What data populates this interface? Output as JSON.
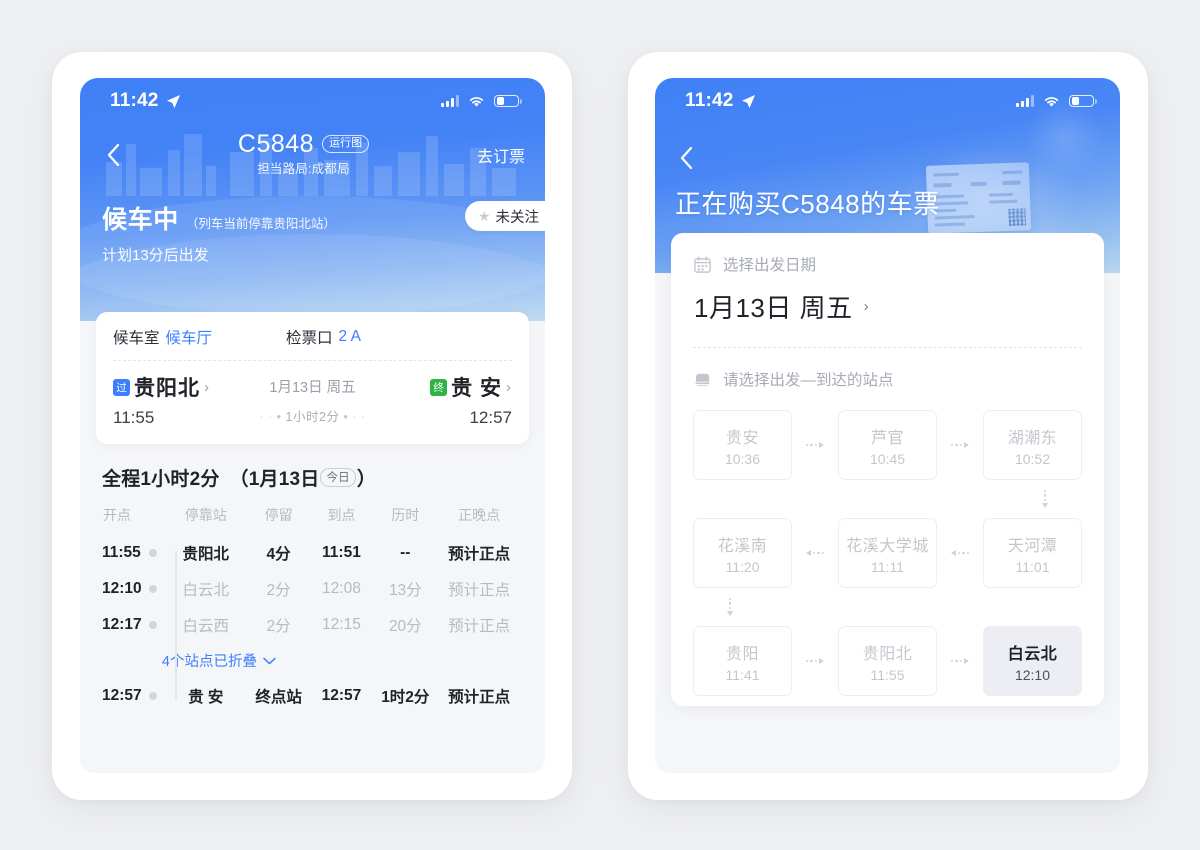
{
  "background_color": "#eff0f2",
  "accent_color": "#3d7eff",
  "header_color": "#3f80f6",
  "left_phone": {
    "status_bar": {
      "time": "11:42",
      "location_icon": "location-arrow-icon",
      "signal_icon": "cellular-signal-icon",
      "wifi_icon": "wifi-icon",
      "battery_icon": "battery-low-icon"
    },
    "nav": {
      "back_icon": "chevron-left-icon",
      "train_number": "C5848",
      "diagram_tag": "运行图",
      "bureau": "担当路局:成都局",
      "book_ticket": "去订票"
    },
    "status": {
      "main": "候车中",
      "sub": "（列车当前停靠贵阳北站）",
      "plan": "计划13分后出发",
      "follow_star_icon": "star-icon",
      "follow_label": "未关注"
    },
    "route_card": {
      "waiting_room_label": "候车室",
      "waiting_room_value": "候车厅",
      "gate_label": "检票口",
      "gate_value": "2 A",
      "origin_badge": "过",
      "origin_name": "贵阳北",
      "origin_time": "11:55",
      "date": "1月13日 周五",
      "duration": "1小时2分",
      "dest_badge": "终",
      "dest_name": "贵 安",
      "dest_time": "12:57"
    },
    "schedule": {
      "title_prefix": "全程1小时2分",
      "title_date": "（1月13日",
      "today_tag": "今日",
      "title_suffix": "）",
      "columns": [
        "开点",
        "停靠站",
        "停留",
        "到点",
        "历时",
        "正晚点"
      ],
      "rows": [
        {
          "depart": "11:55",
          "station": "贵阳北",
          "stay": "4分",
          "arrive": "11:51",
          "elapsed": "--",
          "punctual": "预计正点",
          "style": "strong"
        },
        {
          "depart": "12:10",
          "station": "白云北",
          "stay": "2分",
          "arrive": "12:08",
          "elapsed": "13分",
          "punctual": "预计正点",
          "style": "dim"
        },
        {
          "depart": "12:17",
          "station": "白云西",
          "stay": "2分",
          "arrive": "12:15",
          "elapsed": "20分",
          "punctual": "预计正点",
          "style": "dim"
        }
      ],
      "fold_label": "4个站点已折叠",
      "fold_icon": "chevron-down-icon",
      "last_row": {
        "depart": "12:57",
        "station": "贵 安",
        "stay": "终点站",
        "arrive": "12:57",
        "elapsed": "1时2分",
        "punctual": "预计正点",
        "style": "strong"
      }
    }
  },
  "right_phone": {
    "status_bar": {
      "time": "11:42",
      "location_icon": "location-arrow-icon",
      "signal_icon": "cellular-signal-icon",
      "wifi_icon": "wifi-icon",
      "battery_icon": "battery-low-icon"
    },
    "nav": {
      "back_icon": "chevron-left-icon",
      "title": "正在购买C5848的车票"
    },
    "buy_card": {
      "date_icon": "calendar-icon",
      "date_label": "选择出发日期",
      "date_value": "1月13日  周五",
      "date_caret": "›",
      "station_icon": "train-icon",
      "station_label": "请选择出发—到达的站点",
      "stations": [
        [
          {
            "name": "贵安",
            "time": "10:36",
            "selected": false
          },
          {
            "name": "芦官",
            "time": "10:45",
            "selected": false
          },
          {
            "name": "湖潮东",
            "time": "10:52",
            "selected": false
          }
        ],
        [
          {
            "name": "花溪南",
            "time": "11:20",
            "selected": false
          },
          {
            "name": "花溪大学城",
            "time": "11:11",
            "selected": false
          },
          {
            "name": "天河潭",
            "time": "11:01",
            "selected": false
          }
        ],
        [
          {
            "name": "贵阳",
            "time": "11:41",
            "selected": false
          },
          {
            "name": "贵阳北",
            "time": "11:55",
            "selected": false
          },
          {
            "name": "白云北",
            "time": "12:10",
            "selected": true
          }
        ]
      ]
    }
  }
}
